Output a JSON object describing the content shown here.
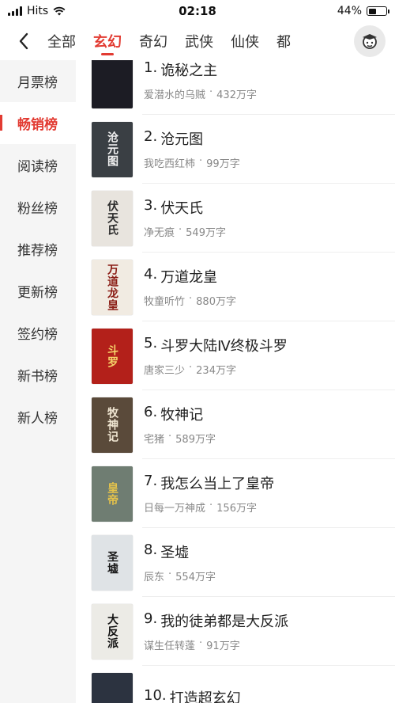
{
  "status_bar": {
    "carrier": "Hits",
    "time": "02:18",
    "battery_text": "44%",
    "battery_level": 0.44
  },
  "header": {
    "back_icon": "chevron-left-icon",
    "tabs": [
      {
        "label": "全部",
        "active": false
      },
      {
        "label": "玄幻",
        "active": true
      },
      {
        "label": "奇幻",
        "active": false
      },
      {
        "label": "武侠",
        "active": false
      },
      {
        "label": "仙侠",
        "active": false
      },
      {
        "label": "都",
        "active": false
      }
    ],
    "avatar_icon": "user-avatar-icon"
  },
  "sidebar": {
    "items": [
      {
        "label": "月票榜",
        "active": false
      },
      {
        "label": "畅销榜",
        "active": true
      },
      {
        "label": "阅读榜",
        "active": false
      },
      {
        "label": "粉丝榜",
        "active": false
      },
      {
        "label": "推荐榜",
        "active": false
      },
      {
        "label": "更新榜",
        "active": false
      },
      {
        "label": "签约榜",
        "active": false
      },
      {
        "label": "新书榜",
        "active": false
      },
      {
        "label": "新人榜",
        "active": false
      }
    ]
  },
  "books": [
    {
      "rank": "1.",
      "title": "诡秘之主",
      "author": "爱潜水的乌贼",
      "separator": "·",
      "words": "432万字",
      "cover_text": "",
      "cover_bg": "#1c1c24",
      "cover_fg": "#c8b27a"
    },
    {
      "rank": "2.",
      "title": "沧元图",
      "author": "我吃西红柿",
      "separator": "·",
      "words": "99万字",
      "cover_text": "沧元图",
      "cover_bg": "#3a3f44",
      "cover_fg": "#f2f2f2"
    },
    {
      "rank": "3.",
      "title": "伏天氏",
      "author": "净无痕",
      "separator": "·",
      "words": "549万字",
      "cover_text": "伏天氏",
      "cover_bg": "#e8e4de",
      "cover_fg": "#2a2a2a"
    },
    {
      "rank": "4.",
      "title": "万道龙皇",
      "author": "牧童听竹",
      "separator": "·",
      "words": "880万字",
      "cover_text": "万道龙皇",
      "cover_bg": "#f1ebe2",
      "cover_fg": "#8a1c14"
    },
    {
      "rank": "5.",
      "title": "斗罗大陆Ⅳ终极斗罗",
      "author": "唐家三少",
      "separator": "·",
      "words": "234万字",
      "cover_text": "斗罗",
      "cover_bg": "#b3201a",
      "cover_fg": "#f5d36a"
    },
    {
      "rank": "6.",
      "title": "牧神记",
      "author": "宅猪",
      "separator": "·",
      "words": "589万字",
      "cover_text": "牧神记",
      "cover_bg": "#5a4a3a",
      "cover_fg": "#f0e6d2"
    },
    {
      "rank": "7.",
      "title": "我怎么当上了皇帝",
      "author": "日每一万神成",
      "separator": "·",
      "words": "156万字",
      "cover_text": "皇帝",
      "cover_bg": "#6f7d72",
      "cover_fg": "#e6c34a"
    },
    {
      "rank": "8.",
      "title": "圣墟",
      "author": "辰东",
      "separator": "·",
      "words": "554万字",
      "cover_text": "圣墟",
      "cover_bg": "#dfe3e6",
      "cover_fg": "#1a1a1a"
    },
    {
      "rank": "9.",
      "title": "我的徒弟都是大反派",
      "author": "谋生任转蓬",
      "separator": "·",
      "words": "91万字",
      "cover_text": "大反派",
      "cover_bg": "#ecebe6",
      "cover_fg": "#111111"
    },
    {
      "rank": "10.",
      "title": "打造超玄幻",
      "author": "",
      "separator": "",
      "words": "",
      "cover_text": "",
      "cover_bg": "#2c3340",
      "cover_fg": "#d6d6d6"
    }
  ],
  "colors": {
    "accent": "#e23b32",
    "sidebar_bg": "#f5f5f5",
    "meta_text": "#888888"
  }
}
